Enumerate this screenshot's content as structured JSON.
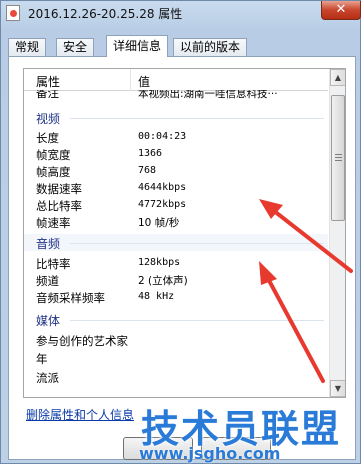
{
  "window": {
    "title": "2016.12.26-20.25.28 属性",
    "close_symbol": "✕",
    "icon": "video-file-icon"
  },
  "tabs": [
    {
      "label": "常规",
      "active": false
    },
    {
      "label": "安全",
      "active": false
    },
    {
      "label": "详细信息",
      "active": true
    },
    {
      "label": "以前的版本",
      "active": false
    }
  ],
  "list": {
    "headers": {
      "property": "属性",
      "value": "值"
    },
    "top_row": {
      "key": "备注",
      "value": "本视频出:湖南一哇信息科技···"
    },
    "sections": [
      {
        "label": "视频",
        "rows": [
          {
            "key": "长度",
            "value": "00:04:23"
          },
          {
            "key": "帧宽度",
            "value": "1366"
          },
          {
            "key": "帧高度",
            "value": "768"
          },
          {
            "key": "数据速率",
            "value": "4644kbps"
          },
          {
            "key": "总比特率",
            "value": "4772kbps"
          },
          {
            "key": "帧速率",
            "value": "10 帧/秒"
          }
        ]
      },
      {
        "label": "音频",
        "rows": [
          {
            "key": "比特率",
            "value": "128kbps"
          },
          {
            "key": "频道",
            "value": "2 (立体声)"
          },
          {
            "key": "音频采样频率",
            "value": "48 kHz"
          }
        ]
      },
      {
        "label": "媒体",
        "rows": [
          {
            "key": "参与创作的艺术家",
            "value": ""
          },
          {
            "key": "年",
            "value": ""
          },
          {
            "key": "流派",
            "value": ""
          }
        ]
      }
    ]
  },
  "remove_link": "删除属性和个人信息",
  "watermark": {
    "title": "技术员联盟",
    "url": "www.jsgho.com"
  },
  "colors": {
    "section_label": "#1e3287",
    "link": "#0a3aa8",
    "arrow": "#e8392f",
    "watermark": "#2a7bd8"
  }
}
